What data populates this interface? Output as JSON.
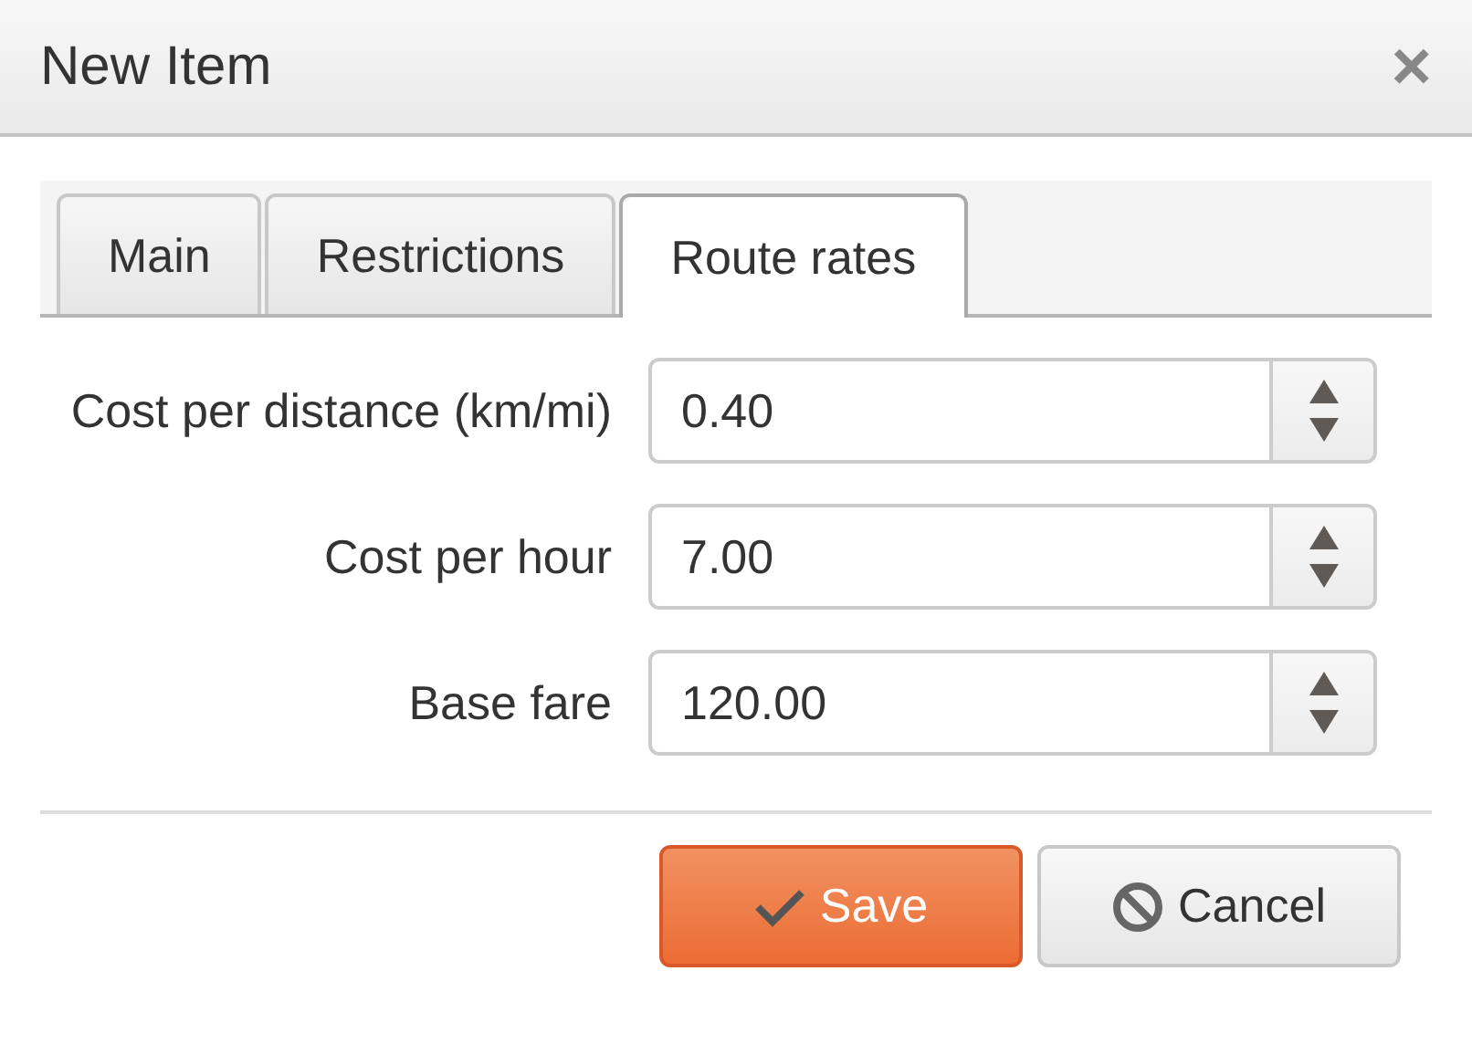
{
  "window": {
    "title": "New Item",
    "close": "×"
  },
  "tabs": [
    {
      "label": "Main",
      "selected": false
    },
    {
      "label": "Restrictions",
      "selected": false
    },
    {
      "label": "Route rates",
      "selected": true
    }
  ],
  "fields": [
    {
      "label": "Cost per distance (km/mi)",
      "value": "0.40"
    },
    {
      "label": "Cost per hour",
      "value": "7.00"
    },
    {
      "label": "Base fare",
      "value": "120.00"
    }
  ],
  "buttons": [
    {
      "kind": "save",
      "label": "Save"
    },
    {
      "kind": "cancel",
      "label": "Cancel"
    }
  ]
}
